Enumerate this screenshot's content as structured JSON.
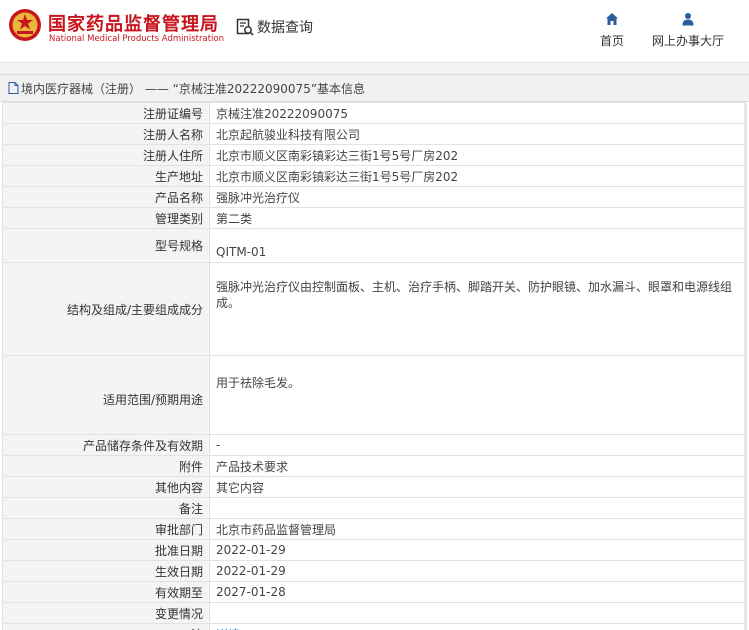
{
  "header": {
    "brand_cn": "国家药品监督管理局",
    "brand_en": "National Medical Products Administration",
    "query_label": "数据查询",
    "nav_home": "首页",
    "nav_hall": "网上办事大厅",
    "brand_color": "#c8151d",
    "nav_icon_color": "#2a5d9f"
  },
  "breadcrumb": {
    "text": "境内医疗器械（注册） —— “京械注准20222090075”基本信息"
  },
  "details": {
    "reg_no": {
      "label": "注册证编号",
      "value": "京械注准20222090075"
    },
    "registrant": {
      "label": "注册人名称",
      "value": "北京起航骏业科技有限公司"
    },
    "address": {
      "label": "注册人住所",
      "value": "北京市顺义区南彩镇彩达三街1号5号厂房202"
    },
    "production": {
      "label": "生产地址",
      "value": "北京市顺义区南彩镇彩达三街1号5号厂房202"
    },
    "product": {
      "label": "产品名称",
      "value": "强脉冲光治疗仪"
    },
    "category": {
      "label": "管理类别",
      "value": "第二类"
    },
    "model": {
      "label": "型号规格",
      "value": "QITM-01"
    },
    "structure": {
      "label": "结构及组成/主要组成成分",
      "value": "强脉冲光治疗仪由控制面板、主机、治疗手柄、脚踏开关、防护眼镜、加水漏斗、眼罩和电源线组成。"
    },
    "purpose": {
      "label": "适用范围/预期用途",
      "value": "用于祛除毛发。"
    },
    "storage": {
      "label": "产品储存条件及有效期",
      "value": "-"
    },
    "attachment": {
      "label": "附件",
      "value": "产品技术要求"
    },
    "other": {
      "label": "其他内容",
      "value": "其它内容"
    },
    "remark": {
      "label": "备注",
      "value": ""
    },
    "dept": {
      "label": "审批部门",
      "value": "北京市药品监督管理局"
    },
    "approve_date": {
      "label": "批准日期",
      "value": "2022-01-29"
    },
    "effective_date": {
      "label": "生效日期",
      "value": "2022-01-29"
    },
    "expiry": {
      "label": "有效期至",
      "value": "2027-01-28"
    },
    "change": {
      "label": "变更情况",
      "value": ""
    },
    "note": {
      "label": "注",
      "value": "详情"
    }
  }
}
